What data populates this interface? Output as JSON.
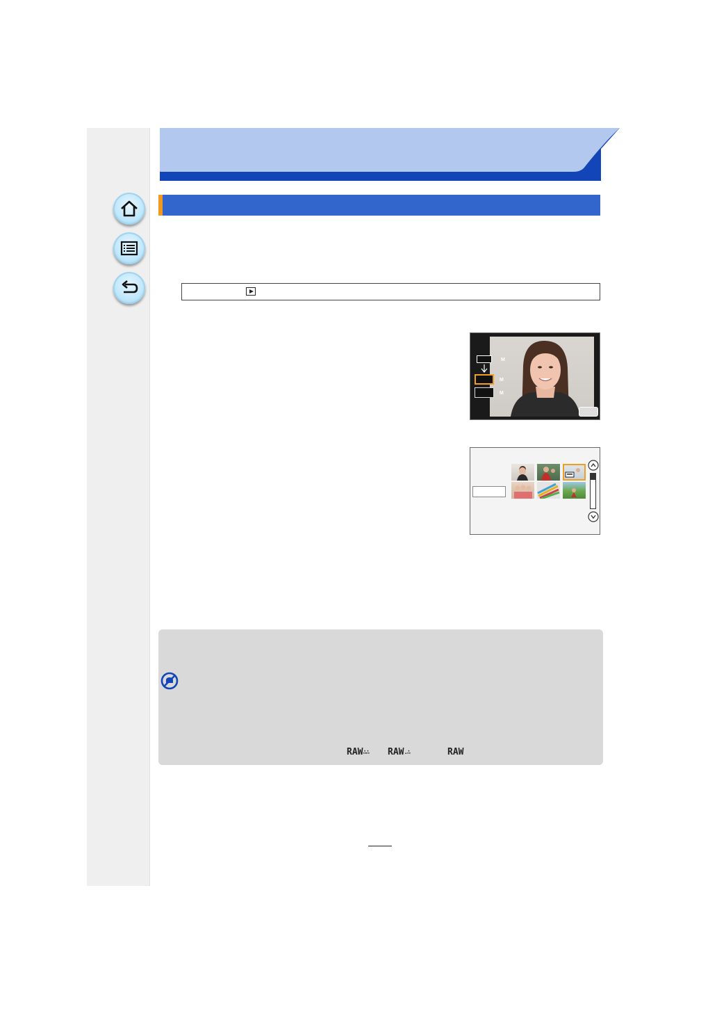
{
  "page": {
    "page_number": ""
  },
  "sidebar": {
    "buttons": [
      {
        "id": "home",
        "icon": "home-icon"
      },
      {
        "id": "contents",
        "icon": "list-icon"
      },
      {
        "id": "back",
        "icon": "back-arrow-icon"
      }
    ]
  },
  "menu_path": {
    "icon": "playback-icon",
    "text": ""
  },
  "note": {
    "icon": "not-available-icon",
    "raw_labels": [
      "RAW",
      "RAW",
      "RAW"
    ]
  },
  "colors": {
    "header_light": "#b3c8ee",
    "header_dark": "#1145b8",
    "section_bar": "#3366cc",
    "section_accent": "#f29a1f",
    "note_bg": "#d9d9d9",
    "highlight": "#f0a020"
  }
}
